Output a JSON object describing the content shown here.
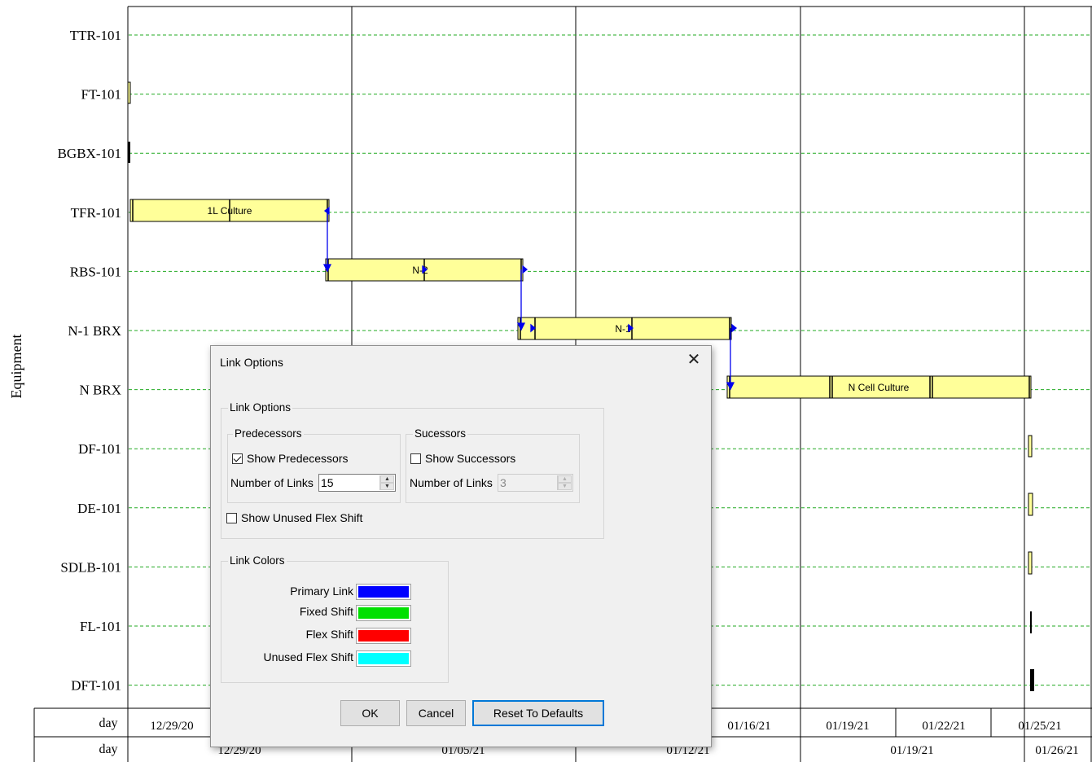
{
  "chart": {
    "y_axis_label": "Equipment",
    "rows": [
      "TTR-101",
      "FT-101",
      "BGBX-101",
      "TFR-101",
      "RBS-101",
      "N-1 BRX",
      "N BRX",
      "DF-101",
      "DE-101",
      "SDLB-101",
      "FL-101",
      "DFT-101"
    ],
    "timeline_row1": {
      "unit": "day",
      "labels": [
        "12/29/20",
        "01/16/21",
        "01/19/21",
        "01/22/21",
        "01/25/21"
      ]
    },
    "timeline_row2": {
      "unit": "day",
      "labels": [
        "12/29/20",
        "01/05/21",
        "01/12/21",
        "01/19/21",
        "01/26/21"
      ]
    },
    "task_labels": [
      "1L Culture",
      "N-2",
      "N-1",
      "N Cell Culture"
    ],
    "colors": {
      "bar_fill": "#ffff99",
      "grid_dashed": "#22aa22",
      "link": "#0000ee"
    }
  },
  "dialog": {
    "title": "Link Options",
    "close_icon": "close-icon",
    "link_options_group": "Link Options",
    "predecessors": {
      "group_title": "Predecessors",
      "show_label": "Show Predecessors",
      "show_checked": true,
      "num_links_label": "Number of Links",
      "num_links_value": "15"
    },
    "successors": {
      "group_title": "Sucessors",
      "show_label": "Show Successors",
      "show_checked": false,
      "num_links_label": "Number of Links",
      "num_links_value": "3"
    },
    "unused_flex": {
      "label": "Show Unused Flex Shift",
      "checked": false
    },
    "link_colors": {
      "group_title": "Link Colors",
      "items": [
        {
          "label": "Primary Link",
          "color": "#0000ff"
        },
        {
          "label": "Fixed Shift",
          "color": "#00e000"
        },
        {
          "label": "Flex Shift",
          "color": "#ff0000"
        },
        {
          "label": "Unused Flex Shift",
          "color": "#00ffff"
        }
      ]
    },
    "buttons": {
      "ok": "OK",
      "cancel": "Cancel",
      "reset": "Reset To Defaults"
    }
  }
}
